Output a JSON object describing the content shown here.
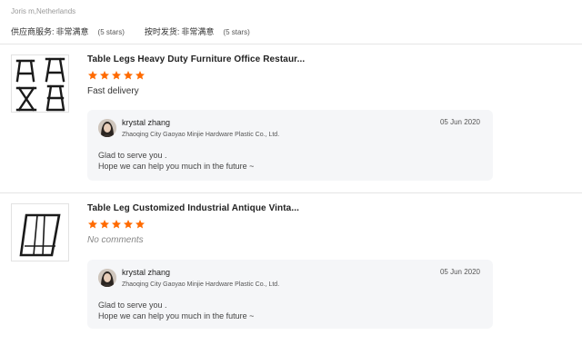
{
  "header": {
    "reviewer": "Joris m,Netherlands",
    "ratings": [
      {
        "label": "供应商服务:",
        "value": "非常满意",
        "stars": "(5 stars)"
      },
      {
        "label": "按时发货:",
        "value": "非常满意",
        "stars": "(5 stars)"
      }
    ]
  },
  "colors": {
    "star": "#ff6a00",
    "reply_bg": "#f5f6f8",
    "divider": "#e5e5e5"
  },
  "reviews": [
    {
      "product_title": "Table Legs Heavy Duty Furniture Office Restaur...",
      "rating": 5,
      "comment": "Fast delivery",
      "thumbnail_icon": "metal-table-legs-set-icon",
      "reply": {
        "name": "krystal zhang",
        "company": "Zhaoqing City Gaoyao Minjie Hardware Plastic Co., Ltd.",
        "date": "05 Jun 2020",
        "line1": "Glad to serve  you .",
        "line2": "Hope we can help you much  in the future ~"
      }
    },
    {
      "product_title": "Table Leg Customized Industrial Antique Vinta...",
      "rating": 5,
      "comment": "No comments",
      "thumbnail_icon": "trapezoid-table-leg-icon",
      "reply": {
        "name": "krystal zhang",
        "company": "Zhaoqing City Gaoyao Minjie Hardware Plastic Co., Ltd.",
        "date": "05 Jun 2020",
        "line1": "Glad to serve  you .",
        "line2": "Hope we can help you much  in the future ~"
      }
    }
  ]
}
